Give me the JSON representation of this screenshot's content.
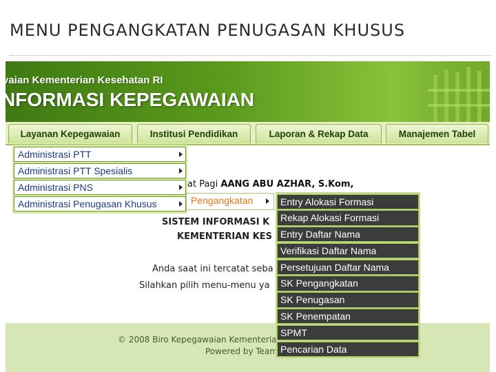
{
  "slide": {
    "title": "MENU PENGANGKATAN PENUGASAN KHUSUS"
  },
  "banner": {
    "subtitle": "vaian Kementerian Kesehatan RI",
    "main_title": "NFORMASI KEPEGAWAIAN"
  },
  "nav": {
    "tabs": [
      {
        "label": "Layanan Kepegawaian"
      },
      {
        "label": "Institusi Pendidikan"
      },
      {
        "label": "Laporan & Rekap Data"
      },
      {
        "label": "Manajemen Tabel"
      }
    ]
  },
  "menu": {
    "items": [
      {
        "label": "Administrasi PTT"
      },
      {
        "label": "Administrasi PTT Spesialis"
      },
      {
        "label": "Administrasi PNS"
      },
      {
        "label": "Administrasi Penugasan Khusus"
      }
    ],
    "submenu": {
      "label": "Pengangkatan"
    },
    "submenu2": {
      "items": [
        {
          "label": "Entry Alokasi Formasi"
        },
        {
          "label": "Rekap Alokasi Formasi"
        },
        {
          "label": "Entry Daftar Nama"
        },
        {
          "label": "Verifikasi Daftar Nama"
        },
        {
          "label": "Persetujuan Daftar Nama"
        },
        {
          "label": "SK Pengangkatan"
        },
        {
          "label": "SK Penugasan"
        },
        {
          "label": "SK Penempatan"
        },
        {
          "label": "SPMT"
        },
        {
          "label": "Pencarian Data"
        }
      ]
    }
  },
  "content": {
    "greeting_prefix": "at Pagi",
    "greeting_name": "AANG ABU AZHAR, S.Kom,",
    "system_line1": "SISTEM INFORMASI K",
    "system_line2": "KEMENTERIAN KES",
    "info_line1": "Anda saat ini tercatat seba",
    "info_line2": "Silahkan pilih menu-menu ya"
  },
  "footer": {
    "line1": "© 2008 Biro Kepegawaian Kementerian",
    "line2": "Powered by Team"
  }
}
